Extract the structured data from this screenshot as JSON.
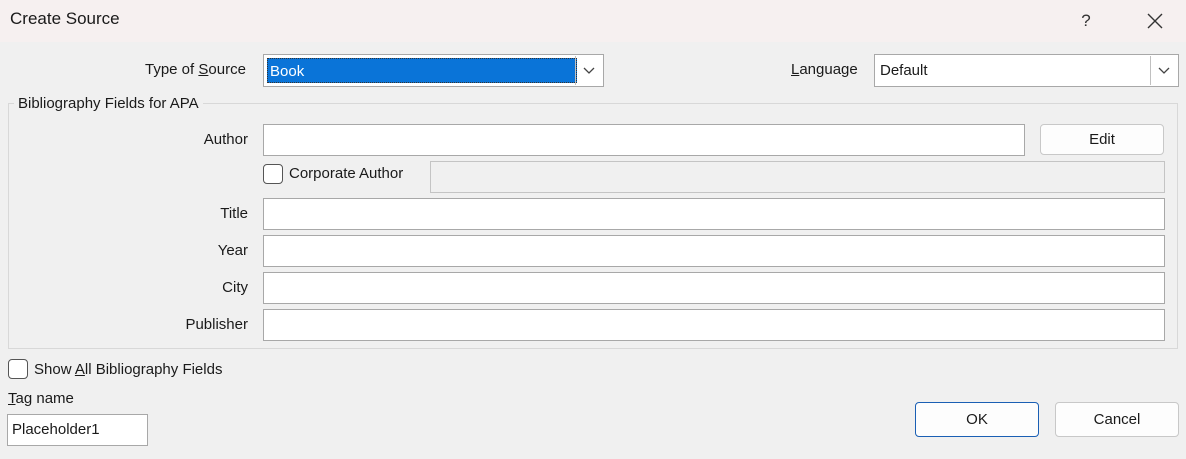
{
  "window": {
    "title": "Create Source",
    "help_glyph": "?"
  },
  "source": {
    "type_label_pre": "Type of ",
    "type_label_key": "S",
    "type_label_post": "ource",
    "type_value": "Book",
    "language_label_key": "L",
    "language_label_post": "anguage",
    "language_value": "Default"
  },
  "group": {
    "legend": "Bibliography Fields for APA"
  },
  "fields": {
    "author_label": "Author",
    "author_value": "",
    "edit_label": "Edit",
    "corporate_author_label": "Corporate Author",
    "corporate_author_value": "",
    "title_label": "Title",
    "title_value": "",
    "year_label": "Year",
    "year_value": "",
    "city_label": "City",
    "city_value": "",
    "publisher_label": "Publisher",
    "publisher_value": ""
  },
  "footer": {
    "show_all_pre": "Show ",
    "show_all_key": "A",
    "show_all_post": "ll Bibliography Fields",
    "tag_label_key": "T",
    "tag_label_post": "ag name",
    "tag_value": "Placeholder1",
    "ok_label": "OK",
    "cancel_label": "Cancel"
  }
}
